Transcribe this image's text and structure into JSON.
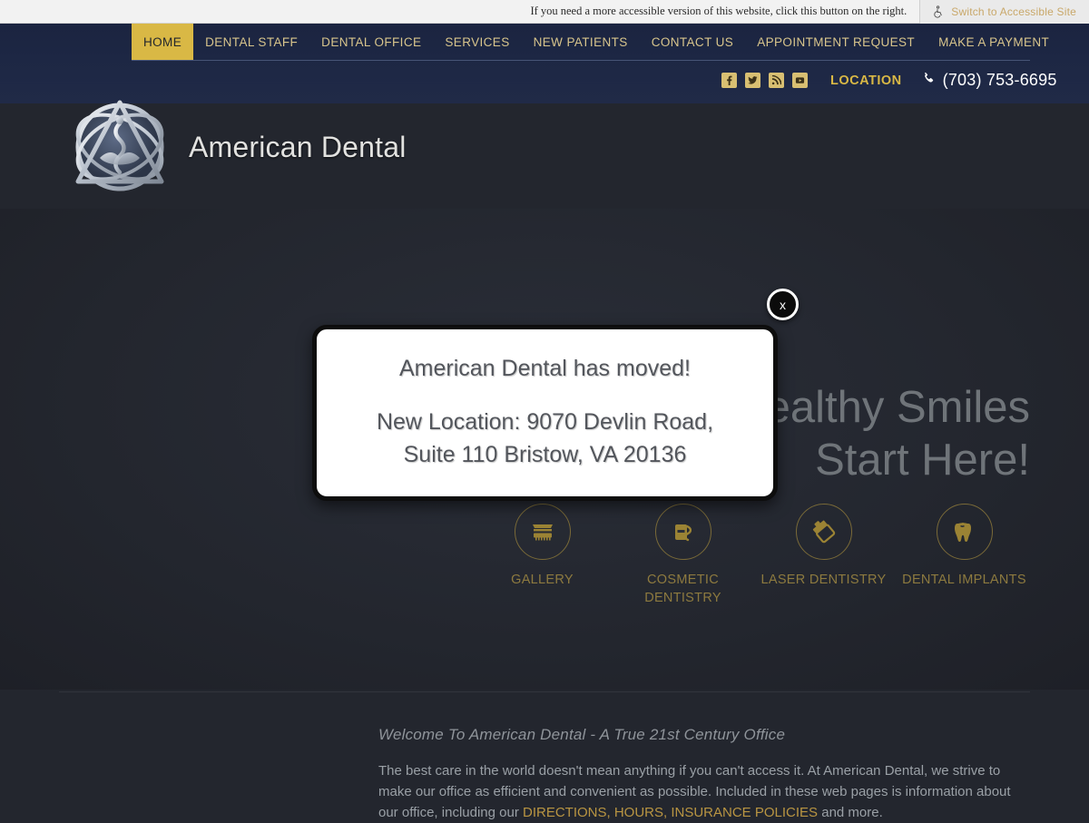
{
  "accessibility": {
    "note": "If you need a more accessible version of this website, click this button on the right.",
    "button_label": "Switch to Accessible Site",
    "icon": "wheelchair-icon"
  },
  "nav": {
    "items": [
      {
        "label": "HOME",
        "active": true
      },
      {
        "label": "DENTAL STAFF",
        "active": false
      },
      {
        "label": "DENTAL OFFICE",
        "active": false
      },
      {
        "label": "SERVICES",
        "active": false
      },
      {
        "label": "NEW PATIENTS",
        "active": false
      },
      {
        "label": "CONTACT US",
        "active": false
      },
      {
        "label": "APPOINTMENT REQUEST",
        "active": false
      },
      {
        "label": "MAKE A PAYMENT",
        "active": false
      }
    ],
    "active_bg": "#d9b845",
    "link_color": "#d8c58c"
  },
  "utility": {
    "social": [
      {
        "name": "facebook-icon",
        "glyph": "f"
      },
      {
        "name": "twitter-icon",
        "glyph": "t"
      },
      {
        "name": "rss-icon",
        "glyph": "r"
      },
      {
        "name": "youtube-icon",
        "glyph": "y"
      }
    ],
    "location_label": "LOCATION",
    "phone": "(703) 753-6695",
    "phone_icon": "phone-icon"
  },
  "brand": {
    "name": "American Dental",
    "logo_icon": "american-dental-emblem-logo"
  },
  "hero": {
    "heading_line1": "Healthy Smiles",
    "heading_line2": "Start Here!",
    "services": [
      {
        "label": "GALLERY",
        "icon": "teeth-brush-icon"
      },
      {
        "label": "COSMETIC DENTISTRY",
        "icon": "dental-floss-icon"
      },
      {
        "label": "LASER DENTISTRY",
        "icon": "toothpaste-tube-icon"
      },
      {
        "label": "DENTAL IMPLANTS",
        "icon": "tooth-icon"
      }
    ],
    "accent_color": "#8d7a3f"
  },
  "modal": {
    "close_label": "x",
    "close_icon": "close-icon",
    "line1": "American Dental has moved!",
    "line2a": "New Location: 9070 Devlin Road,",
    "line2b": "Suite 110 Bristow, VA 20136"
  },
  "welcome": {
    "heading": "Welcome To American Dental - A True 21st Century Office",
    "body_1": "The best care in the world doesn't mean anything if you can't access it. At American Dental, we strive to make our office as efficient and convenient as possible. Included in these web pages is information about",
    "body_2": "our office, including our ",
    "body_link": "DIRECTIONS, HOURS, INSURANCE POLICIES",
    "body_3": " and more."
  },
  "colors": {
    "header_navy": "#1d2744",
    "gold": "#d9b845",
    "page_bg": "#23262e"
  }
}
